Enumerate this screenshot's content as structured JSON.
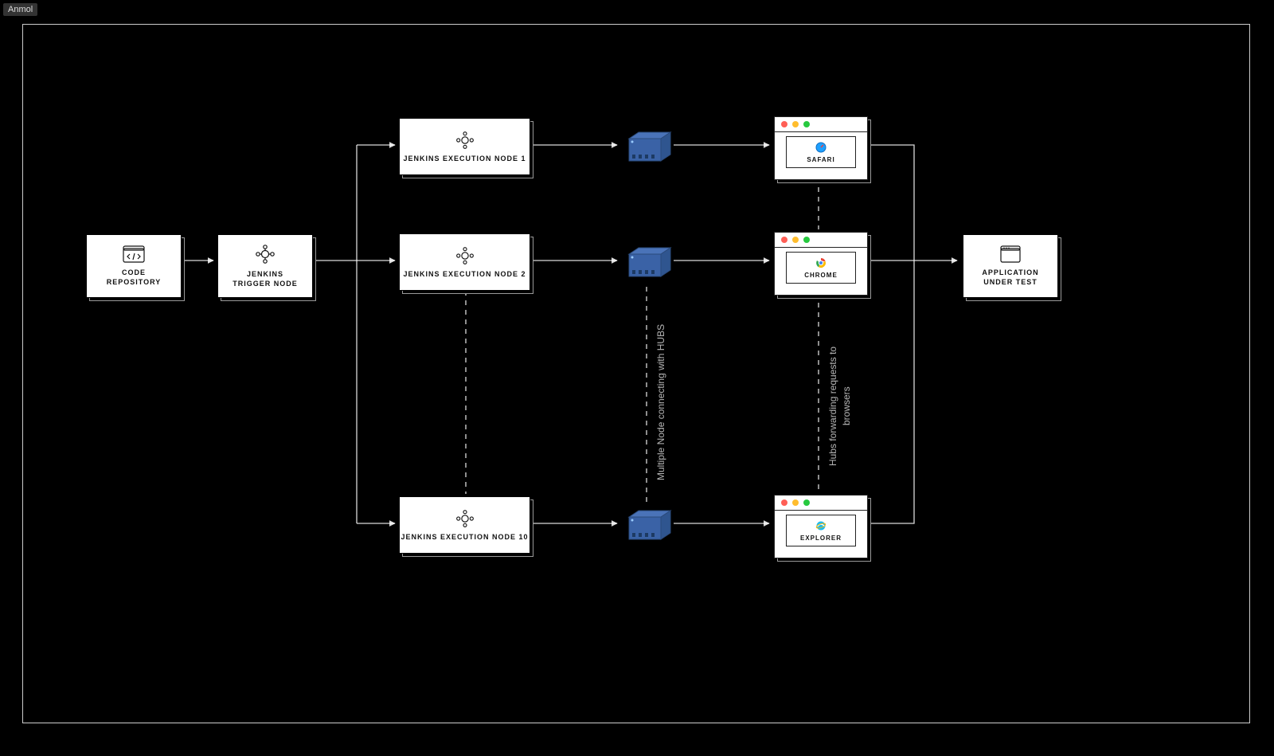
{
  "watermark": "Anmol",
  "nodes": {
    "code_repo": {
      "line1": "CODE",
      "line2": "REPOSITORY"
    },
    "trigger": {
      "line1": "JENKINS",
      "line2": "TRIGGER NODE"
    },
    "exec1": {
      "label": "JENKINS EXECUTION NODE 1"
    },
    "exec2": {
      "label": "JENKINS EXECUTION NODE 2"
    },
    "exec10": {
      "label": "JENKINS EXECUTION NODE 10"
    },
    "app": {
      "line1": "APPLICATION",
      "line2": "UNDER TEST"
    }
  },
  "browsers": {
    "safari": {
      "label": "SAFARI"
    },
    "chrome": {
      "label": "CHROME"
    },
    "explorer": {
      "label": "EXPLORER"
    }
  },
  "captions": {
    "hubs": "Multiple Node connecting with HUBS",
    "forwarding": "Hubs forwarding requests to browsers"
  }
}
